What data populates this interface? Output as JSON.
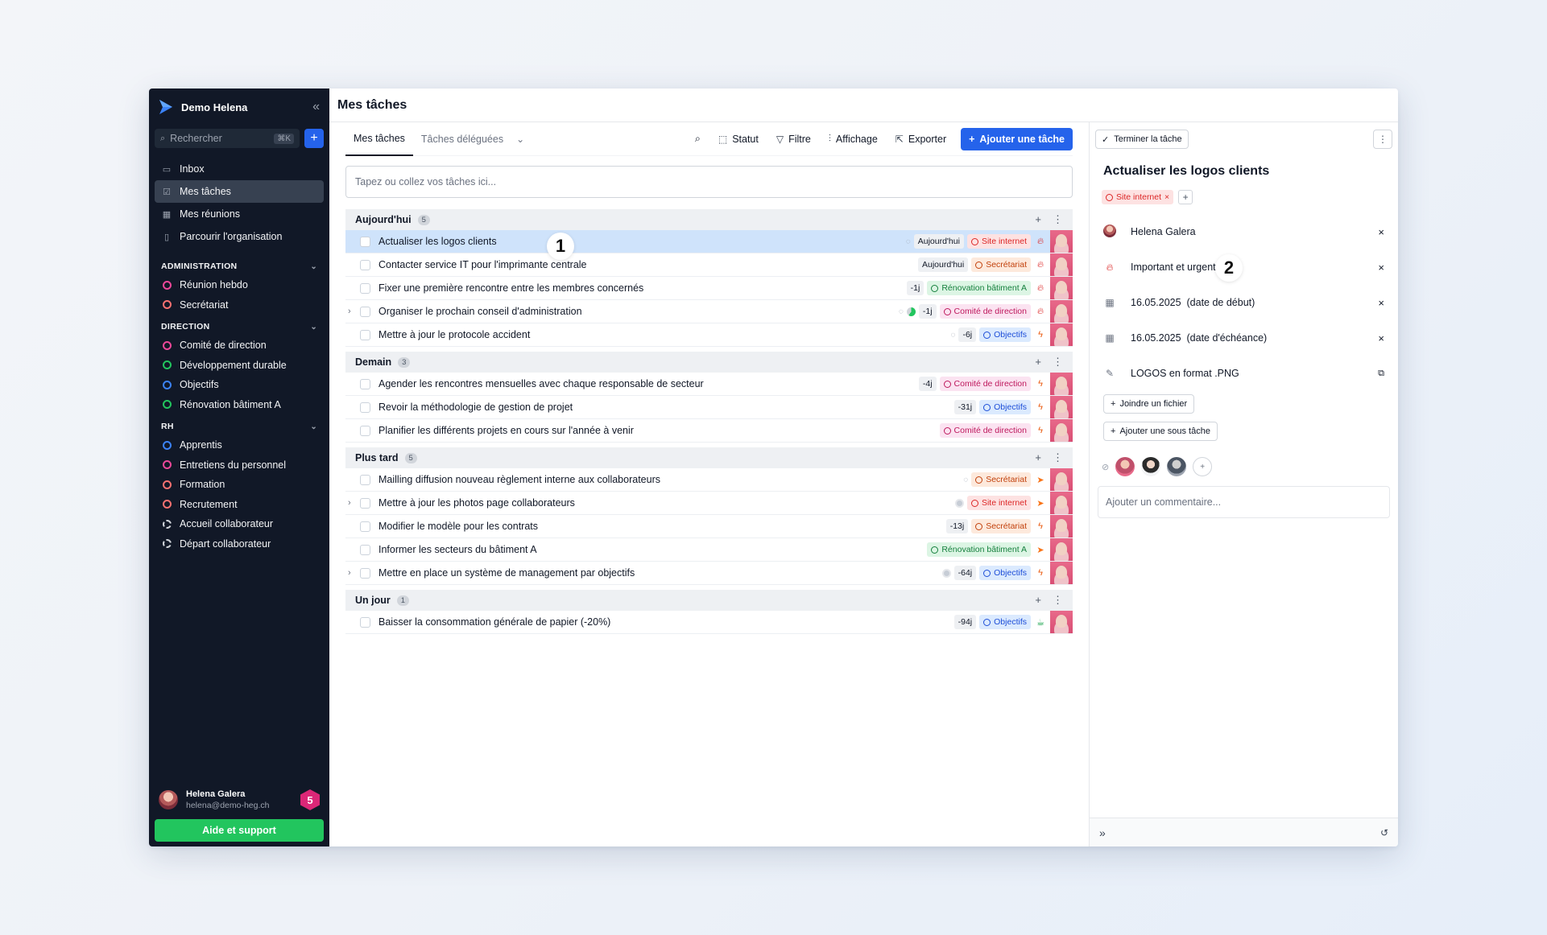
{
  "workspace": {
    "name": "Demo Helena"
  },
  "sidebar": {
    "search_placeholder": "Rechercher",
    "search_shortcut": "⌘K",
    "nav": [
      {
        "label": "Inbox",
        "icon": "inbox-icon"
      },
      {
        "label": "Mes tâches",
        "icon": "checkbox-icon"
      },
      {
        "label": "Mes réunions",
        "icon": "calendar-icon"
      },
      {
        "label": "Parcourir l'organisation",
        "icon": "building-icon"
      }
    ],
    "sections": [
      {
        "title": "ADMINISTRATION",
        "items": [
          {
            "label": "Réunion hebdo",
            "color": "#ec4899"
          },
          {
            "label": "Secrétariat",
            "color": "#f87171"
          }
        ]
      },
      {
        "title": "DIRECTION",
        "items": [
          {
            "label": "Comité de direction",
            "color": "#ec4899"
          },
          {
            "label": "Développement durable",
            "color": "#22c55e"
          },
          {
            "label": "Objectifs",
            "color": "#3b82f6"
          },
          {
            "label": "Rénovation bâtiment A",
            "color": "#22c55e"
          }
        ]
      },
      {
        "title": "RH",
        "items": [
          {
            "label": "Apprentis",
            "color": "#3b82f6"
          },
          {
            "label": "Entretiens du personnel",
            "color": "#ec4899"
          },
          {
            "label": "Formation",
            "color": "#f87171"
          },
          {
            "label": "Recrutement",
            "color": "#f87171"
          },
          {
            "label": "Accueil collaborateur",
            "color": "dashed"
          },
          {
            "label": "Départ collaborateur",
            "color": "dashed"
          }
        ]
      }
    ],
    "user": {
      "name": "Helena Galera",
      "email": "helena@demo-heg.ch",
      "badge": "5"
    },
    "help_label": "Aide et support"
  },
  "main": {
    "title": "Mes tâches",
    "tabs": [
      "Mes tâches",
      "Tâches déléguées"
    ],
    "toolbar": {
      "statut": "Statut",
      "filtre": "Filtre",
      "affichage": "Affichage",
      "exporter": "Exporter",
      "add": "Ajouter une tâche"
    },
    "quick_placeholder": "Tapez ou collez vos tâches ici...",
    "groups": [
      {
        "name": "Aujourd'hui",
        "count": "5",
        "tasks": [
          {
            "title": "Actualiser les logos clients",
            "comment": true,
            "due": "Aujourd'hui",
            "tag": "Site internet",
            "tagc": "site",
            "prio": "fire",
            "selected": true
          },
          {
            "title": "Contacter service IT pour l'imprimante centrale",
            "due": "Aujourd'hui",
            "tag": "Secrétariat",
            "tagc": "sec",
            "prio": "fire"
          },
          {
            "title": "Fixer une première rencontre entre les membres concernés",
            "due": "-1j",
            "tag": "Rénovation bâtiment A",
            "tagc": "ren",
            "prio": "fire"
          },
          {
            "title": "Organiser le prochain conseil d'administration",
            "expand": true,
            "comment": true,
            "progress": true,
            "due": "-1j",
            "tag": "Comité de direction",
            "tagc": "com",
            "prio": "fire"
          },
          {
            "title": "Mettre à jour le protocole accident",
            "comment": true,
            "due": "-6j",
            "tag": "Objectifs",
            "tagc": "obj",
            "prio": "bolt"
          }
        ]
      },
      {
        "name": "Demain",
        "count": "3",
        "tasks": [
          {
            "title": "Agender les rencontres mensuelles avec chaque responsable de secteur",
            "due": "-4j",
            "tag": "Comité de direction",
            "tagc": "com",
            "prio": "bolt"
          },
          {
            "title": "Revoir la méthodologie de gestion de projet",
            "due": "-31j",
            "tag": "Objectifs",
            "tagc": "obj",
            "prio": "bolt"
          },
          {
            "title": "Planifier les différents projets en cours sur l'année à venir",
            "tag": "Comité de direction",
            "tagc": "com",
            "prio": "bolt"
          }
        ]
      },
      {
        "name": "Plus tard",
        "count": "5",
        "tasks": [
          {
            "title": "Mailling diffusion nouveau règlement interne aux collaborateurs",
            "comment": true,
            "tag": "Secrétariat",
            "tagc": "sec",
            "prio": "send"
          },
          {
            "title": "Mettre à jour les photos page collaborateurs",
            "expand": true,
            "dot": true,
            "tag": "Site internet",
            "tagc": "site",
            "prio": "send"
          },
          {
            "title": "Modifier le modèle pour les contrats",
            "due": "-13j",
            "tag": "Secrétariat",
            "tagc": "sec",
            "prio": "bolt"
          },
          {
            "title": "Informer les secteurs du bâtiment A",
            "tag": "Rénovation bâtiment A",
            "tagc": "ren",
            "prio": "send"
          },
          {
            "title": "Mettre en place un système de management par objectifs",
            "expand": true,
            "dot": true,
            "due": "-64j",
            "tag": "Objectifs",
            "tagc": "obj",
            "prio": "bolt"
          }
        ]
      },
      {
        "name": "Un jour",
        "count": "1",
        "tasks": [
          {
            "title": "Baisser la consommation générale de papier (-20%)",
            "due": "-94j",
            "tag": "Objectifs",
            "tagc": "obj",
            "prio": "cup"
          }
        ]
      }
    ],
    "markers": [
      "1",
      "2"
    ]
  },
  "detail": {
    "finish": "Terminer la tâche",
    "title": "Actualiser les logos clients",
    "tag": "Site internet",
    "assignee": "Helena Galera",
    "priority": "Important et urgent",
    "start": "16.05.2025  (date de début)",
    "due": "16.05.2025  (date d'échéance)",
    "link": "LOGOS en format .PNG",
    "attach": "Joindre un fichier",
    "subtask": "Ajouter une sous tâche",
    "comment_placeholder": "Ajouter un commentaire..."
  }
}
